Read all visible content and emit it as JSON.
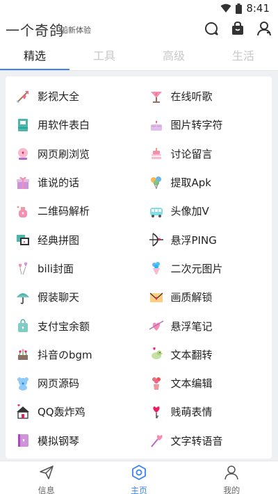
{
  "status": {
    "time": "8:41",
    "icons": [
      "wifi-icon",
      "battery-icon"
    ]
  },
  "header": {
    "title": "一个奇鸽",
    "subtitle": "船新体验",
    "icons": [
      "chat-bubble-icon",
      "bag-icon",
      "user-icon"
    ]
  },
  "tabs": [
    {
      "label": "精选",
      "active": true
    },
    {
      "label": "工具",
      "active": false
    },
    {
      "label": "高级",
      "active": false
    },
    {
      "label": "生活",
      "active": false
    }
  ],
  "items": [
    {
      "label": "影视大全",
      "icon": "cupid-arrow-icon"
    },
    {
      "label": "在线听歌",
      "icon": "heart-cup-icon"
    },
    {
      "label": "用软件表白",
      "icon": "notebook-icon"
    },
    {
      "label": "图片转字符",
      "icon": "cake-icon"
    },
    {
      "label": "网页刷浏览",
      "icon": "crystal-ball-icon"
    },
    {
      "label": "讨论留言",
      "icon": "layer-cake-icon"
    },
    {
      "label": "谁说的话",
      "icon": "gift-box-icon"
    },
    {
      "label": "提取Apk",
      "icon": "balloons-icon"
    },
    {
      "label": "二维码解析",
      "icon": "perfume-icon"
    },
    {
      "label": "头像加V",
      "icon": "bus-icon"
    },
    {
      "label": "经典拼图",
      "icon": "photo-frames-icon"
    },
    {
      "label": "悬浮PING",
      "icon": "bow-arrow-icon"
    },
    {
      "label": "bili封面",
      "icon": "heart-balloons-icon"
    },
    {
      "label": "二次元图片",
      "icon": "bouquet-icon"
    },
    {
      "label": "假装聊天",
      "icon": "umbrella-icon"
    },
    {
      "label": "画质解锁",
      "icon": "love-letter-icon"
    },
    {
      "label": "支付宝余额",
      "icon": "shopping-bag-icon"
    },
    {
      "label": "悬浮笔记",
      "icon": "heart-arrow-icon"
    },
    {
      "label": "抖音のbgm",
      "icon": "planter-icon"
    },
    {
      "label": "文本翻转",
      "icon": "bird-icon"
    },
    {
      "label": "网页源码",
      "icon": "teddy-bear-icon"
    },
    {
      "label": "文本编辑",
      "icon": "flower-vase-icon"
    },
    {
      "label": "QQ轰炸鸡",
      "icon": "house-icon"
    },
    {
      "label": "贱萌表情",
      "icon": "heart-key-icon"
    },
    {
      "label": "模拟钢琴",
      "icon": "diary-icon"
    },
    {
      "label": "文字转语音",
      "icon": "heart-wand-icon"
    }
  ],
  "bottom_nav": [
    {
      "label": "信息",
      "icon": "send-icon",
      "active": false
    },
    {
      "label": "主页",
      "icon": "home-hexagon-icon",
      "active": true
    },
    {
      "label": "我的",
      "icon": "profile-icon",
      "active": false
    }
  ],
  "colors": {
    "accent": "#3b82f6",
    "pink": "#f48fb1",
    "purple": "#c9a7f0",
    "teal": "#6fd6d0"
  }
}
